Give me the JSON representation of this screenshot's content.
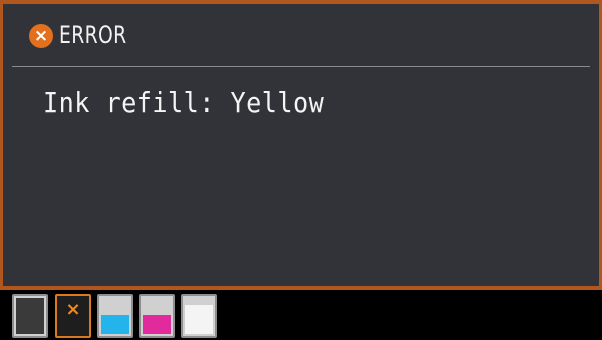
{
  "header": {
    "title": "ERROR",
    "icon": "error-x-icon",
    "icon_glyph": "×",
    "accent_color": "#e2701e"
  },
  "message": "Ink refill: Yellow",
  "ink_cartridges": [
    {
      "name": "black",
      "color": "#3a3a3a",
      "level": 0.95,
      "status": "ok"
    },
    {
      "name": "yellow",
      "color": "#f2d400",
      "level": 0,
      "status": "error",
      "glyph": "×"
    },
    {
      "name": "cyan",
      "color": "#22b4ea",
      "level": 0.5,
      "status": "ok"
    },
    {
      "name": "magenta",
      "color": "#e12a9c",
      "level": 0.5,
      "status": "ok"
    },
    {
      "name": "photo-white",
      "color": "#f4f4f4",
      "level": 0.75,
      "status": "ok"
    }
  ]
}
